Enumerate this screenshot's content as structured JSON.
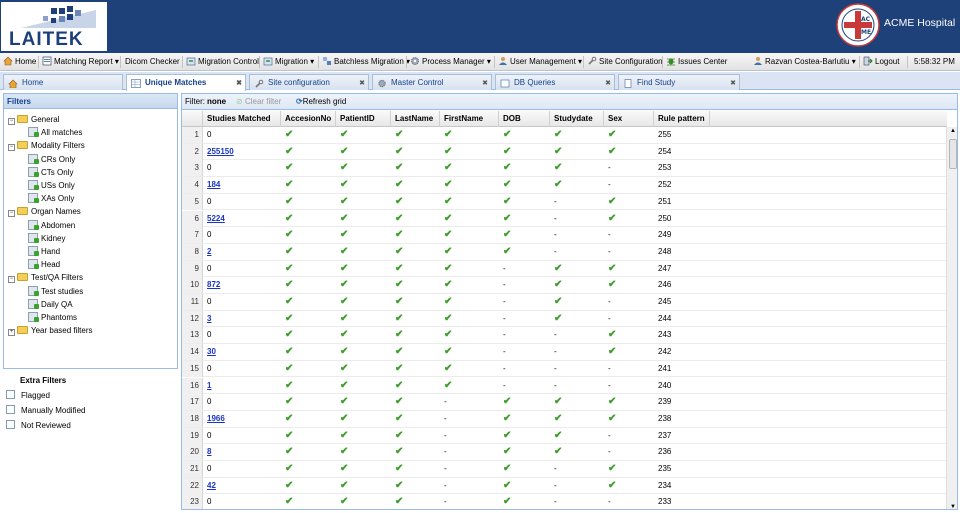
{
  "header": {
    "brand": "LAITEK",
    "hospital": "ACME Hospital",
    "seal_text": "ACME"
  },
  "menu": [
    {
      "label": "Home",
      "icon": "home-icon",
      "dropdown": false
    },
    {
      "label": "Matching Report",
      "icon": "report-icon",
      "dropdown": true
    },
    {
      "label": "Dicom Checker",
      "icon": "",
      "dropdown": false
    },
    {
      "label": "Migration Control",
      "icon": "migration-icon",
      "dropdown": false
    },
    {
      "label": "Migration",
      "icon": "migration-icon",
      "dropdown": true
    },
    {
      "label": "Batchless Migration",
      "icon": "batch-icon",
      "dropdown": true
    },
    {
      "label": "Process Manager",
      "icon": "gear-icon",
      "dropdown": true
    },
    {
      "label": "User Management",
      "icon": "user-icon",
      "dropdown": true
    },
    {
      "label": "Site Configuration",
      "icon": "wrench-icon",
      "dropdown": false
    },
    {
      "label": "Issues Center",
      "icon": "bug-icon",
      "dropdown": false
    },
    {
      "label": "Razvan Costea-Barlutiu",
      "icon": "user-icon",
      "dropdown": true
    },
    {
      "label": "Logout",
      "icon": "logout-icon",
      "dropdown": false
    }
  ],
  "clock": "5:58:32 PM",
  "tabs": [
    {
      "label": "Home",
      "closable": false,
      "active": false
    },
    {
      "label": "Unique Matches",
      "closable": true,
      "active": true
    },
    {
      "label": "Site configuration",
      "closable": true,
      "active": false
    },
    {
      "label": "Master Control",
      "closable": true,
      "active": false
    },
    {
      "label": "DB Queries",
      "closable": true,
      "active": false
    },
    {
      "label": "Find Study",
      "closable": true,
      "active": false
    }
  ],
  "filters": {
    "title": "Filters",
    "groups": [
      {
        "label": "General",
        "items": [
          "All matches"
        ]
      },
      {
        "label": "Modality Filters",
        "items": [
          "CRs Only",
          "CTs Only",
          "USs Only",
          "XAs Only"
        ]
      },
      {
        "label": "Organ Names",
        "items": [
          "Abdomen",
          "Kidney",
          "Hand",
          "Head"
        ]
      },
      {
        "label": "Test/QA Filters",
        "items": [
          "Test studies",
          "Daily QA",
          "Phantoms"
        ]
      },
      {
        "label": "Year based filters",
        "items": []
      }
    ]
  },
  "extra_filters": {
    "title": "Extra Filters",
    "items": [
      "Flagged",
      "Manually Modified",
      "Not Reviewed"
    ]
  },
  "grid": {
    "filter_label": "Filter:",
    "filter_value": "none",
    "clear_filter": "Clear filter",
    "refresh": "Refresh grid",
    "columns": [
      "Studies Matched",
      "AccesionNo",
      "PatientID",
      "LastName",
      "FirstName",
      "DOB",
      "Studydate",
      "Sex",
      "Rule pattern"
    ],
    "rows": [
      {
        "n": "1",
        "studies": "0",
        "link": false,
        "flags": [
          1,
          1,
          1,
          1,
          1,
          1,
          1
        ],
        "rule": "255"
      },
      {
        "n": "2",
        "studies": "255150",
        "link": true,
        "flags": [
          1,
          1,
          1,
          1,
          1,
          1,
          1
        ],
        "rule": "254"
      },
      {
        "n": "3",
        "studies": "0",
        "link": false,
        "flags": [
          1,
          1,
          1,
          1,
          1,
          1,
          0
        ],
        "rule": "253"
      },
      {
        "n": "4",
        "studies": "184",
        "link": true,
        "flags": [
          1,
          1,
          1,
          1,
          1,
          1,
          0
        ],
        "rule": "252"
      },
      {
        "n": "5",
        "studies": "0",
        "link": false,
        "flags": [
          1,
          1,
          1,
          1,
          1,
          0,
          1
        ],
        "rule": "251"
      },
      {
        "n": "6",
        "studies": "5224",
        "link": true,
        "flags": [
          1,
          1,
          1,
          1,
          1,
          0,
          1
        ],
        "rule": "250"
      },
      {
        "n": "7",
        "studies": "0",
        "link": false,
        "flags": [
          1,
          1,
          1,
          1,
          1,
          0,
          0
        ],
        "rule": "249"
      },
      {
        "n": "8",
        "studies": "2",
        "link": true,
        "flags": [
          1,
          1,
          1,
          1,
          1,
          0,
          0
        ],
        "rule": "248"
      },
      {
        "n": "9",
        "studies": "0",
        "link": false,
        "flags": [
          1,
          1,
          1,
          1,
          0,
          1,
          1
        ],
        "rule": "247"
      },
      {
        "n": "10",
        "studies": "872",
        "link": true,
        "flags": [
          1,
          1,
          1,
          1,
          0,
          1,
          1
        ],
        "rule": "246"
      },
      {
        "n": "11",
        "studies": "0",
        "link": false,
        "flags": [
          1,
          1,
          1,
          1,
          0,
          1,
          0
        ],
        "rule": "245"
      },
      {
        "n": "12",
        "studies": "3",
        "link": true,
        "flags": [
          1,
          1,
          1,
          1,
          0,
          1,
          0
        ],
        "rule": "244"
      },
      {
        "n": "13",
        "studies": "0",
        "link": false,
        "flags": [
          1,
          1,
          1,
          1,
          0,
          0,
          1
        ],
        "rule": "243"
      },
      {
        "n": "14",
        "studies": "30",
        "link": true,
        "flags": [
          1,
          1,
          1,
          1,
          0,
          0,
          1
        ],
        "rule": "242"
      },
      {
        "n": "15",
        "studies": "0",
        "link": false,
        "flags": [
          1,
          1,
          1,
          1,
          0,
          0,
          0
        ],
        "rule": "241"
      },
      {
        "n": "16",
        "studies": "1",
        "link": true,
        "flags": [
          1,
          1,
          1,
          1,
          0,
          0,
          0
        ],
        "rule": "240"
      },
      {
        "n": "17",
        "studies": "0",
        "link": false,
        "flags": [
          1,
          1,
          1,
          0,
          1,
          1,
          1
        ],
        "rule": "239"
      },
      {
        "n": "18",
        "studies": "1966",
        "link": true,
        "flags": [
          1,
          1,
          1,
          0,
          1,
          1,
          1
        ],
        "rule": "238"
      },
      {
        "n": "19",
        "studies": "0",
        "link": false,
        "flags": [
          1,
          1,
          1,
          0,
          1,
          1,
          0
        ],
        "rule": "237"
      },
      {
        "n": "20",
        "studies": "8",
        "link": true,
        "flags": [
          1,
          1,
          1,
          0,
          1,
          1,
          0
        ],
        "rule": "236"
      },
      {
        "n": "21",
        "studies": "0",
        "link": false,
        "flags": [
          1,
          1,
          1,
          0,
          1,
          0,
          1
        ],
        "rule": "235"
      },
      {
        "n": "22",
        "studies": "42",
        "link": true,
        "flags": [
          1,
          1,
          1,
          0,
          1,
          0,
          1
        ],
        "rule": "234"
      },
      {
        "n": "23",
        "studies": "0",
        "link": false,
        "flags": [
          1,
          1,
          1,
          0,
          1,
          0,
          0
        ],
        "rule": "233"
      }
    ]
  },
  "colors": {
    "header": "#1e4179",
    "link": "#1a35c3",
    "check": "#3e9e2c",
    "panel_border": "#99bbe8"
  }
}
